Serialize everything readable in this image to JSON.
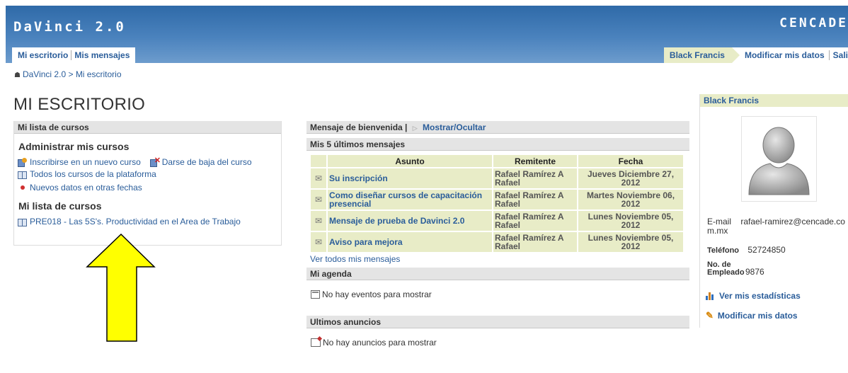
{
  "header": {
    "logo": "DaVinci 2.0",
    "brand": "CENCADE",
    "nav_left": [
      "Mi escritorio",
      "Mis mensajes"
    ],
    "user_tab": "Black Francis",
    "modify_link": "Modificar mis datos",
    "truncated_link": "Sali"
  },
  "breadcrumb": {
    "home": "DaVinci 2.0 >",
    "current": "Mi escritorio"
  },
  "page_title": "MI ESCRITORIO",
  "left": {
    "bar": "Mi lista de cursos",
    "admin_heading": "Administrar mis cursos",
    "enroll": "Inscribirse en un nuevo curso",
    "unenroll": "Darse de baja del curso",
    "all_courses": "Todos los cursos de la plataforma",
    "new_dates": "Nuevos datos en otras fechas",
    "list_heading": "Mi lista de cursos",
    "course": "PRE018 - Las 5S's. Productividad en el Area de Trabajo"
  },
  "middle": {
    "welcome_bar": "Mensaje de bienvenida |",
    "toggle": "Mostrar/Ocultar",
    "messages_bar": "Mis 5 últimos mensajes",
    "columns": [
      "Asunto",
      "Remitente",
      "Fecha"
    ],
    "messages": [
      {
        "subject": "Su inscripción",
        "from": "Rafael Ramírez A Rafael",
        "date": "Jueves Diciembre 27, 2012"
      },
      {
        "subject": "Como diseñar cursos de capacitación presencial",
        "from": "Rafael Ramírez A Rafael",
        "date": "Martes Noviembre 06, 2012"
      },
      {
        "subject": "Mensaje de prueba de Davinci 2.0",
        "from": "Rafael Ramírez A Rafael",
        "date": "Lunes Noviembre 05, 2012"
      },
      {
        "subject": "Aviso para mejora",
        "from": "Rafael Ramírez A Rafael",
        "date": "Lunes Noviembre 05, 2012"
      }
    ],
    "see_all": "Ver todos mis mensajes",
    "agenda_bar": "Mi agenda",
    "no_events": "No hay eventos para mostrar",
    "news_bar": "Ultimos anuncios",
    "no_news": "No hay anuncios para mostrar"
  },
  "profile": {
    "name": "Black Francis",
    "email_label": "E-mail",
    "email_value": "rafael-ramirez@cencade.com.mx",
    "phone_label": "Teléfono",
    "phone_value": "52724850",
    "employee_label": "No. de Empleado",
    "employee_value": "9876",
    "stats_link": "Ver mis estadísticas",
    "modify_link": "Modificar mis datos"
  },
  "annotation": {
    "arrow_color": "#ffff00"
  }
}
